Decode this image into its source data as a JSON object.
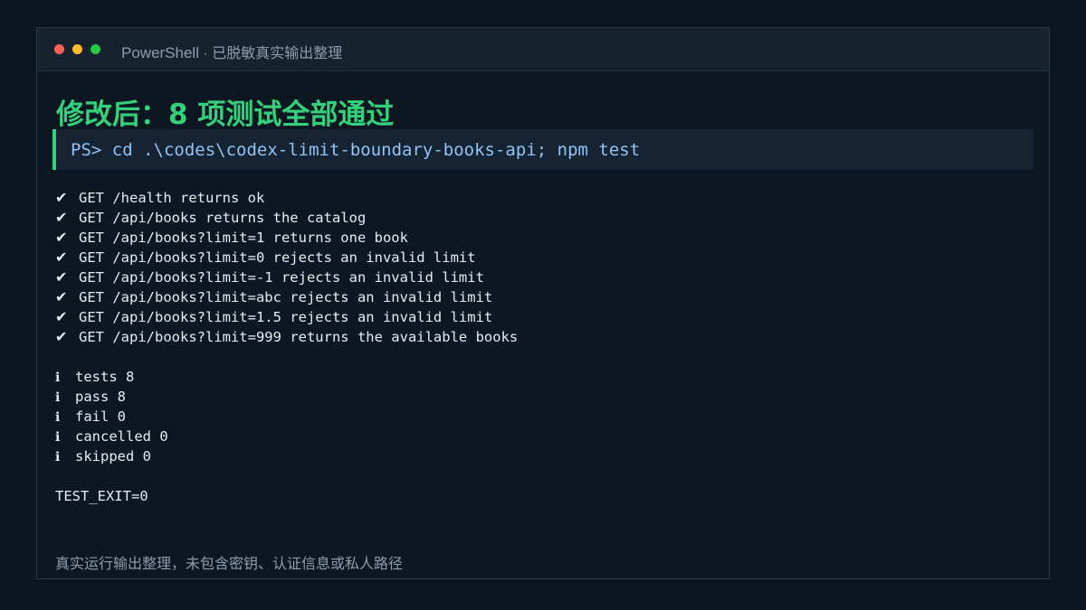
{
  "window": {
    "app_name": "PowerShell",
    "separator": " · ",
    "subtitle": "已脱敏真实输出整理"
  },
  "heading": "修改后：8 项测试全部通过",
  "command": "PS> cd .\\codes\\codex-limit-boundary-books-api; npm test",
  "tests": [
    {
      "mark": "✔",
      "text": "GET /health returns ok"
    },
    {
      "mark": "✔",
      "text": "GET /api/books returns the catalog"
    },
    {
      "mark": "✔",
      "text": "GET /api/books?limit=1 returns one book"
    },
    {
      "mark": "✔",
      "text": "GET /api/books?limit=0 rejects an invalid limit"
    },
    {
      "mark": "✔",
      "text": "GET /api/books?limit=-1 rejects an invalid limit"
    },
    {
      "mark": "✔",
      "text": "GET /api/books?limit=abc rejects an invalid limit"
    },
    {
      "mark": "✔",
      "text": "GET /api/books?limit=1.5 rejects an invalid limit"
    },
    {
      "mark": "✔",
      "text": "GET /api/books?limit=999 returns the available books"
    }
  ],
  "summary": [
    {
      "mark": "ℹ",
      "text": "tests 8"
    },
    {
      "mark": "ℹ",
      "text": "pass 8"
    },
    {
      "mark": "ℹ",
      "text": "fail 0"
    },
    {
      "mark": "ℹ",
      "text": "cancelled 0"
    },
    {
      "mark": "ℹ",
      "text": "skipped 0"
    }
  ],
  "exit_line": "TEST_EXIT=0",
  "footer": "真实运行输出整理，未包含密钥、认证信息或私人路径",
  "colors": {
    "accent_green": "#34d17a",
    "command_blue": "#93c3f3",
    "text": "#e6ecf2",
    "muted": "#8e9cad",
    "background": "#0b1520"
  }
}
